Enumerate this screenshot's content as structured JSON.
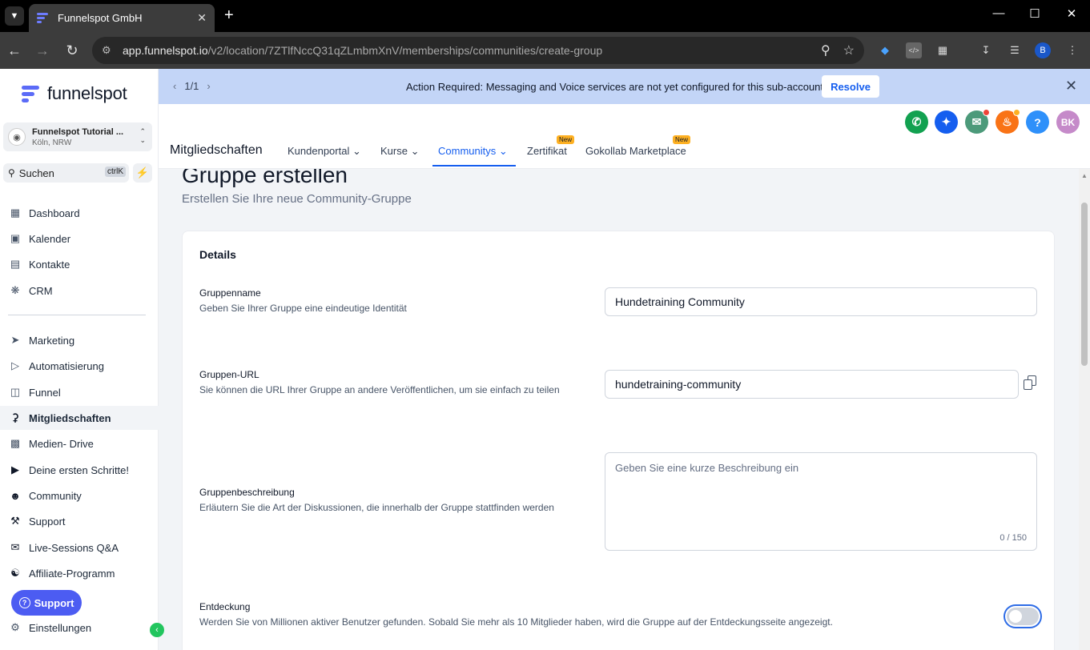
{
  "browser": {
    "tab_title": "Funnelspot GmbH",
    "url_host": "app.funnelspot.io",
    "url_path": "/v2/location/7ZTlfNccQ31qZLmbmXnV/memberships/communities/create-group",
    "profile_initial": "B"
  },
  "sidebar": {
    "logo_text": "funnelspot",
    "account_name": "Funnelspot Tutorial ...",
    "account_location": "Köln, NRW",
    "search_label": "Suchen",
    "search_shortcut": "ctrlK",
    "items": [
      {
        "label": "Dashboard",
        "icon": "grid-icon"
      },
      {
        "label": "Kalender",
        "icon": "calendar-icon"
      },
      {
        "label": "Kontakte",
        "icon": "contacts-icon"
      },
      {
        "label": "CRM",
        "icon": "crm-icon"
      },
      {
        "label": "Marketing",
        "icon": "send-icon"
      },
      {
        "label": "Automatisierung",
        "icon": "automation-icon"
      },
      {
        "label": "Funnel",
        "icon": "funnel-icon"
      },
      {
        "label": "Mitgliedschaften",
        "icon": "award-icon"
      },
      {
        "label": "Medien- Drive",
        "icon": "image-icon"
      },
      {
        "label": "Deine ersten Schritte!",
        "icon": "play-icon"
      },
      {
        "label": "Community",
        "icon": "users-icon"
      },
      {
        "label": "Support",
        "icon": "wrench-icon"
      },
      {
        "label": "Live-Sessions Q&A",
        "icon": "chat-icon"
      },
      {
        "label": "Affiliate-Programm",
        "icon": "hand-coin-icon"
      },
      {
        "label": "Einstellungen",
        "icon": "gear-icon"
      }
    ],
    "active_item": "Mitgliedschaften",
    "support_button": "Support"
  },
  "banner": {
    "pager": "1/1",
    "message": "Action Required: Messaging and Voice services are not yet configured for this sub-account!",
    "resolve_label": "Resolve"
  },
  "header": {
    "title": "Mitgliedschaften",
    "tabs": [
      {
        "label": "Kundenportal",
        "has_chevron": true,
        "badge": ""
      },
      {
        "label": "Kurse",
        "has_chevron": true,
        "badge": ""
      },
      {
        "label": "Communitys",
        "has_chevron": true,
        "badge": ""
      },
      {
        "label": "Zertifikat",
        "has_chevron": false,
        "badge": "New"
      },
      {
        "label": "Gokollab Marketplace",
        "has_chevron": false,
        "badge": "New"
      }
    ],
    "active_tab": "Communitys",
    "avatar_initials": "BK",
    "colors": {
      "phone": "#12a150",
      "ai": "#155eef",
      "megaphone": "#4c9a7a",
      "bell": "#f97316",
      "help": "#2e90fa",
      "avatar": "#c58ac9"
    }
  },
  "page": {
    "title": "Gruppe erstellen",
    "subtitle": "Erstellen Sie Ihre neue Community-Gruppe",
    "card_heading": "Details",
    "fields": {
      "name": {
        "label": "Gruppenname",
        "help": "Geben Sie Ihrer Gruppe eine eindeutige Identität",
        "value": "Hundetraining Community"
      },
      "url": {
        "label": "Gruppen-URL",
        "help": "Sie können die URL Ihrer Gruppe an andere Veröffentlichen, um sie einfach zu teilen",
        "value": "hundetraining-community"
      },
      "description": {
        "label": "Gruppenbeschreibung",
        "help": "Erläutern Sie die Art der Diskussionen, die innerhalb der Gruppe stattfinden werden",
        "placeholder": "Geben Sie eine kurze Beschreibung ein",
        "counter": "0 / 150"
      },
      "discovery": {
        "label": "Entdeckung",
        "help": "Werden Sie von Millionen aktiver Benutzer gefunden. Sobald Sie mehr als 10 Mitglieder haben, wird die Gruppe auf der Entdeckungsseite angezeigt.",
        "enabled": false
      }
    }
  }
}
